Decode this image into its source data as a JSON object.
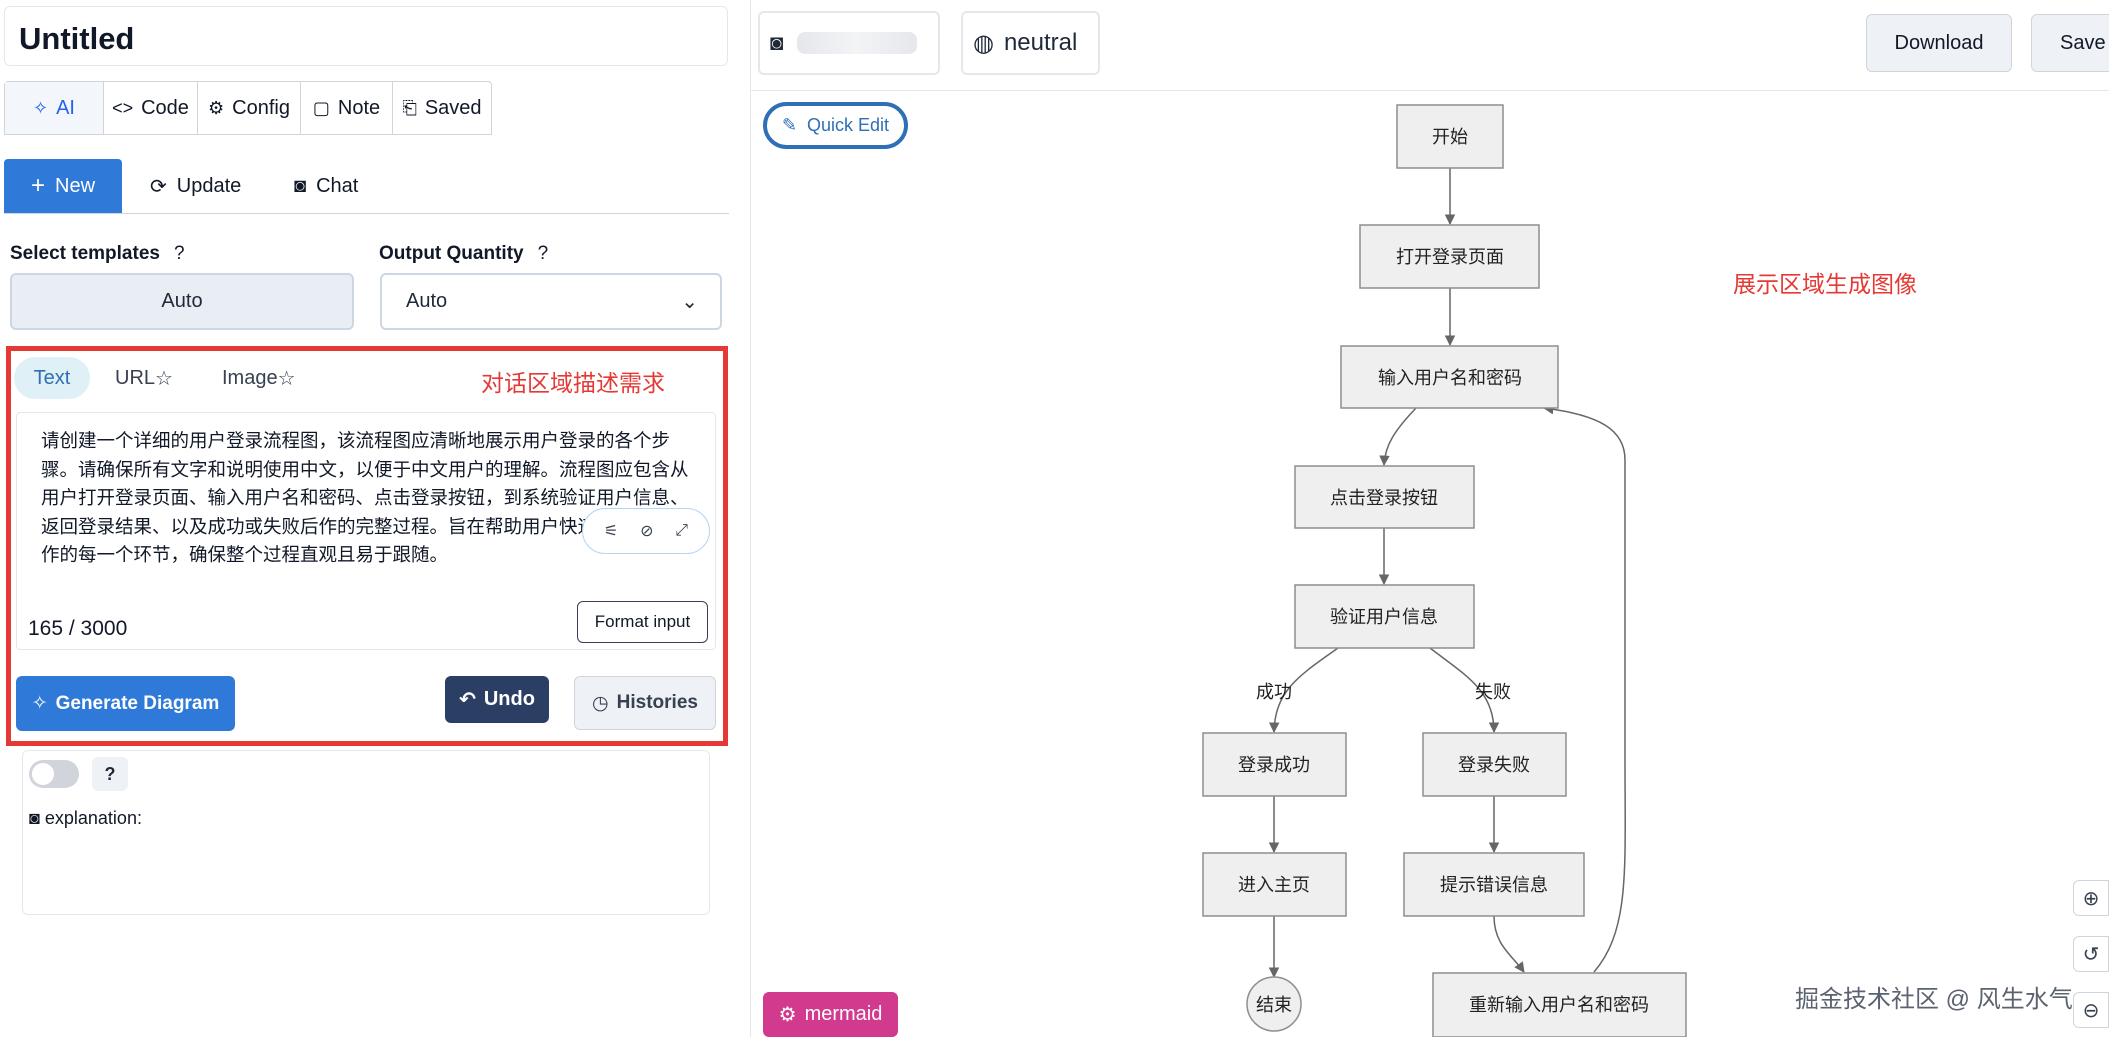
{
  "doc": {
    "title": "Untitled"
  },
  "tabs": [
    {
      "icon": "✧",
      "label": "AI"
    },
    {
      "icon": "<>",
      "label": "Code"
    },
    {
      "icon": "⚙",
      "label": "Config"
    },
    {
      "icon": "▢",
      "label": "Note"
    },
    {
      "icon": "⎗",
      "label": "Saved"
    }
  ],
  "modes": {
    "new": "New",
    "update": "Update",
    "chat": "Chat"
  },
  "templates": {
    "label": "Select templates",
    "help": "?",
    "value": "Auto"
  },
  "quantity": {
    "label": "Output Quantity",
    "help": "?",
    "value": "Auto"
  },
  "input_tabs": {
    "text": "Text",
    "url": "URL",
    "image": "Image"
  },
  "annotations": {
    "input_area": "对话区域描述需求",
    "display_area": "展示区域生成图像"
  },
  "prompt": {
    "text": "请创建一个详细的用户登录流程图，该流程图应清晰地展示用户登录的各个步骤。请确保所有文字和说明使用中文，以便于中文用户的理解。流程图应包含从用户打开登录页面、输入用户名和密码、点击登录按钮，到系统验证用户信息、返回登录结果、以及成功或失败后作的完整过程。旨在帮助用户快速了解登陆操作的每一个环节，确保整个过程直观且易于跟随。",
    "counter": "165 / 3000",
    "format_label": "Format input"
  },
  "actions": {
    "generate": "Generate Diagram",
    "undo": "Undo",
    "histories": "Histories"
  },
  "explanation": {
    "toggle_help": "?",
    "label": "explanation:"
  },
  "toolbar": {
    "theme_neutral": "neutral",
    "download": "Download",
    "save": "Save"
  },
  "canvas": {
    "quick_edit": "Quick Edit",
    "renderer": "mermaid",
    "watermark": "掘金技术社区 @ 风生水气"
  },
  "flow": {
    "nodes": {
      "start": "开始",
      "open_login": "打开登录页面",
      "input_cred": "输入用户名和密码",
      "click_login": "点击登录按钮",
      "verify": "验证用户信息",
      "success": "登录成功",
      "fail": "登录失败",
      "home": "进入主页",
      "error": "提示错误信息",
      "end": "结束",
      "reinput": "重新输入用户名和密码"
    },
    "edges": {
      "success_label": "成功",
      "fail_label": "失败"
    }
  },
  "colors": {
    "accent": "#2f7ad8",
    "annotation_red": "#e53935",
    "undo_navy": "#2b3f64",
    "mermaid_pink": "#d13a8d"
  }
}
